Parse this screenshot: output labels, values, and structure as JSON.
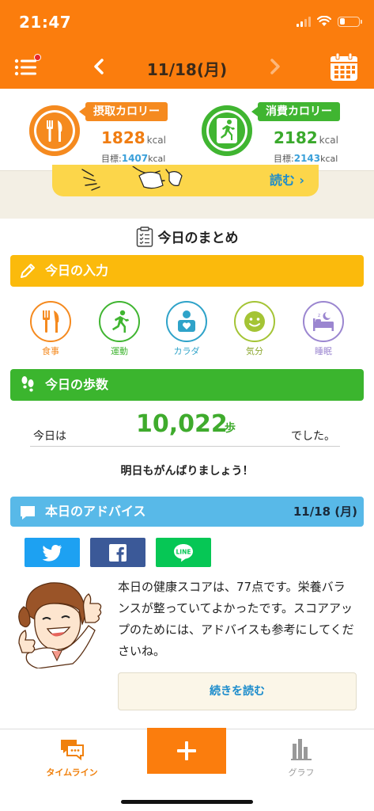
{
  "status_bar": {
    "time": "21:47"
  },
  "header": {
    "date": "11/18(月)"
  },
  "calories": {
    "intake": {
      "label": "摂取カロリー",
      "value": "1828",
      "unit": "kcal",
      "goal_label": "目標:",
      "goal_value": "1407",
      "goal_unit": "kcal",
      "progress": 1.0,
      "color": "#f58a1f"
    },
    "burn": {
      "label": "消費カロリー",
      "value": "2182",
      "unit": "kcal",
      "goal_label": "目標:",
      "goal_value": "2143",
      "goal_unit": "kcal",
      "progress": 1.0,
      "color": "#40b531"
    }
  },
  "banner": {
    "link": "読む ›"
  },
  "summary": {
    "title": "今日のまとめ"
  },
  "today_input": {
    "title": "今日の入力",
    "items": [
      {
        "label": "食事",
        "icon": "fork-knife-icon",
        "color": "#f58a1f"
      },
      {
        "label": "運動",
        "icon": "running-icon",
        "color": "#40b531"
      },
      {
        "label": "カラダ",
        "icon": "body-icon",
        "color": "#2fa3c9"
      },
      {
        "label": "気分",
        "icon": "smile-icon",
        "color": "#a4c435"
      },
      {
        "label": "睡眠",
        "icon": "sleep-icon",
        "color": "#9b86d0"
      }
    ]
  },
  "steps": {
    "title": "今日の歩数",
    "prefix": "今日は",
    "value": "10,022",
    "unit": "歩",
    "suffix": "でした。",
    "cheer": "明日もがんばりましょう！"
  },
  "advice": {
    "title": "本日のアドバイス",
    "date": "11/18 (月)",
    "share": {
      "line_label": "LINE"
    },
    "text": "本日の健康スコアは、77点です。栄養バランスが整っていてよかったです。スコアアップのためには、アドバイスも参考にしてくださいね。",
    "more": "続きを読む"
  },
  "tabs": {
    "timeline": "タイムライン",
    "graph": "グラフ"
  },
  "colors": {
    "brand": "#fb7d0d",
    "accent_blue": "#1c8ccc",
    "steps_green": "#3fab2d"
  }
}
